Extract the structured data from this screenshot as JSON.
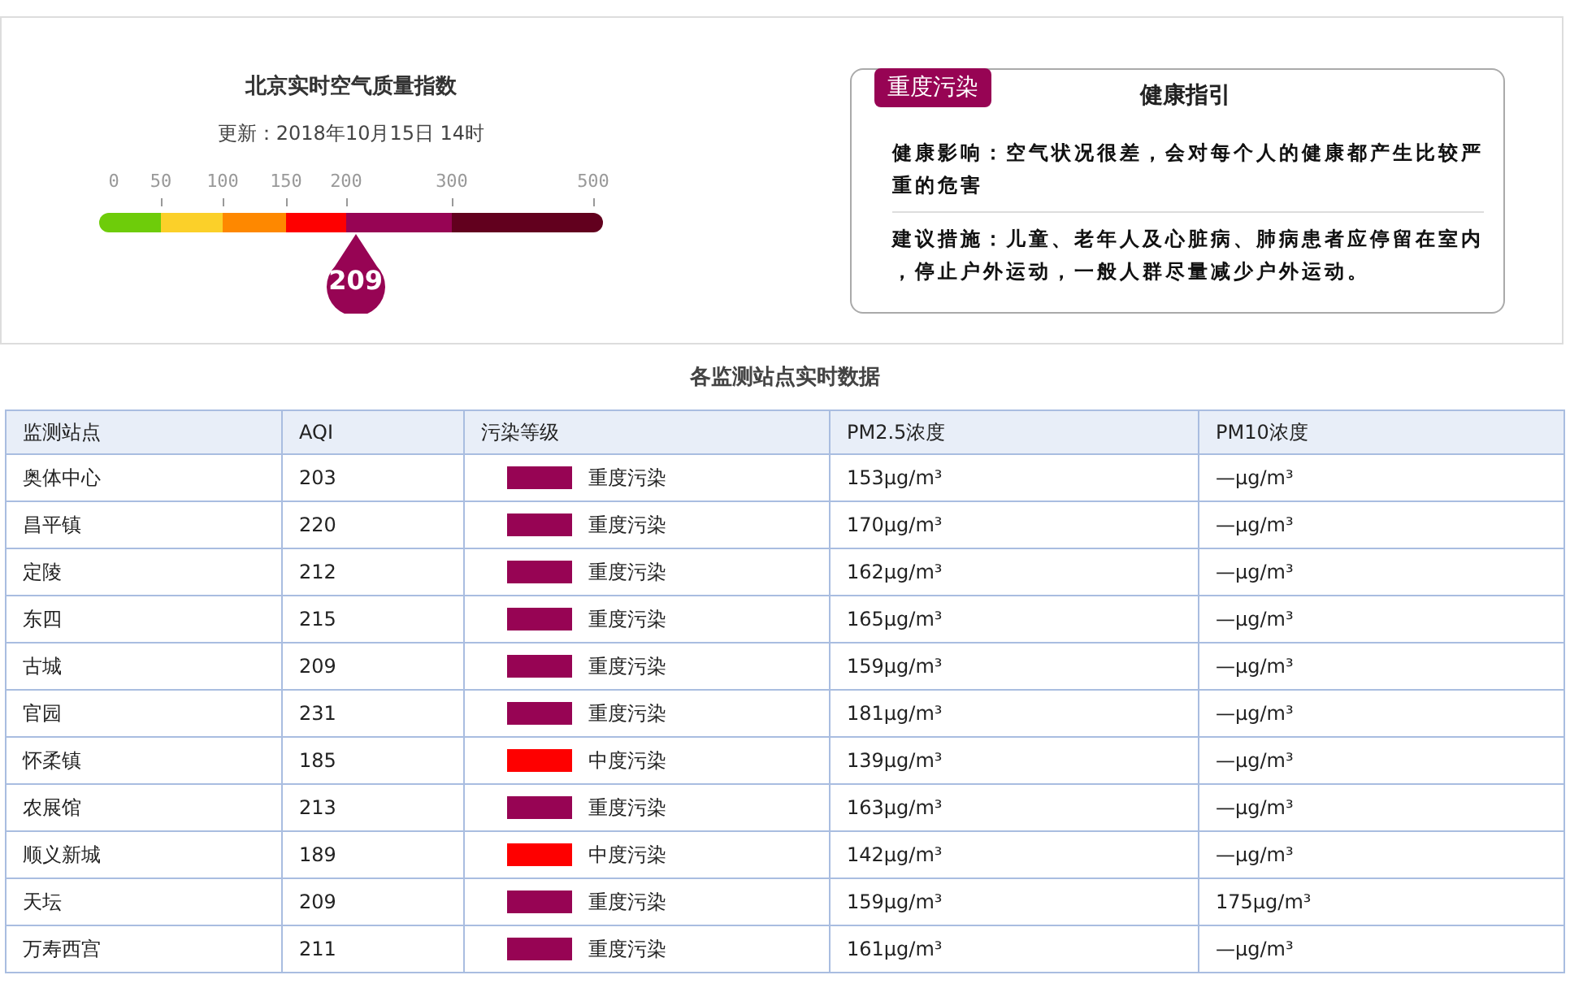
{
  "summary": {
    "title": "北京实时空气质量指数",
    "updated": "更新：2018年10月15日 14时",
    "scale": {
      "ticks": [
        "0",
        "50",
        "100",
        "150",
        "200",
        "300",
        "500"
      ],
      "segments": [
        {
          "color": "#6ecc0a"
        },
        {
          "color": "#fbd029"
        },
        {
          "color": "#fe8800"
        },
        {
          "color": "#fe0000"
        },
        {
          "color": "#970454"
        },
        {
          "color": "#62001e"
        }
      ]
    },
    "marker": {
      "value": "209",
      "color": "#970454"
    }
  },
  "guide": {
    "badge": {
      "text": "重度污染",
      "color": "#970454"
    },
    "title": "健康指引",
    "impact": "健康影响：空气状况很差，会对每个人的健康都产生比较严重的危害",
    "advice": "建议措施：儿童、老年人及心脏病、肺病患者应停留在室内，停止户外运动，一般人群尽量减少户外运动。"
  },
  "table": {
    "title": "各监测站点实时数据",
    "columns": [
      "监测站点",
      "AQI",
      "污染等级",
      "PM2.5浓度",
      "PM10浓度"
    ],
    "rows": [
      {
        "station": "奥体中心",
        "aqi": "203",
        "grade": "重度污染",
        "color": "#970454",
        "pm25": "153μg/m³",
        "pm10": "—μg/m³"
      },
      {
        "station": "昌平镇",
        "aqi": "220",
        "grade": "重度污染",
        "color": "#970454",
        "pm25": "170μg/m³",
        "pm10": "—μg/m³"
      },
      {
        "station": "定陵",
        "aqi": "212",
        "grade": "重度污染",
        "color": "#970454",
        "pm25": "162μg/m³",
        "pm10": "—μg/m³"
      },
      {
        "station": "东四",
        "aqi": "215",
        "grade": "重度污染",
        "color": "#970454",
        "pm25": "165μg/m³",
        "pm10": "—μg/m³"
      },
      {
        "station": "古城",
        "aqi": "209",
        "grade": "重度污染",
        "color": "#970454",
        "pm25": "159μg/m³",
        "pm10": "—μg/m³"
      },
      {
        "station": "官园",
        "aqi": "231",
        "grade": "重度污染",
        "color": "#970454",
        "pm25": "181μg/m³",
        "pm10": "—μg/m³"
      },
      {
        "station": "怀柔镇",
        "aqi": "185",
        "grade": "中度污染",
        "color": "#fe0000",
        "pm25": "139μg/m³",
        "pm10": "—μg/m³"
      },
      {
        "station": "农展馆",
        "aqi": "213",
        "grade": "重度污染",
        "color": "#970454",
        "pm25": "163μg/m³",
        "pm10": "—μg/m³"
      },
      {
        "station": "顺义新城",
        "aqi": "189",
        "grade": "中度污染",
        "color": "#fe0000",
        "pm25": "142μg/m³",
        "pm10": "—μg/m³"
      },
      {
        "station": "天坛",
        "aqi": "209",
        "grade": "重度污染",
        "color": "#970454",
        "pm25": "159μg/m³",
        "pm10": "175μg/m³"
      },
      {
        "station": "万寿西宫",
        "aqi": "211",
        "grade": "重度污染",
        "color": "#970454",
        "pm25": "161μg/m³",
        "pm10": "—μg/m³"
      }
    ]
  }
}
